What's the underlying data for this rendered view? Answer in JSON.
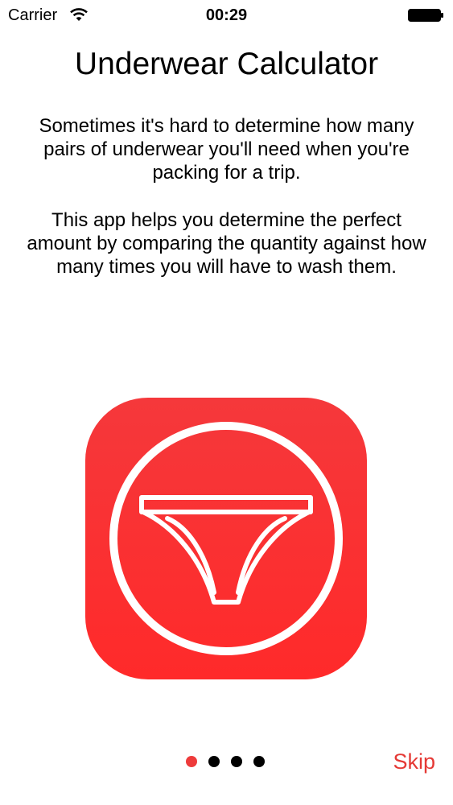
{
  "status_bar": {
    "carrier": "Carrier",
    "time": "00:29",
    "wifi_icon": "wifi-icon",
    "battery_icon": "battery-icon"
  },
  "title": "Underwear Calculator",
  "paragraphs": [
    "Sometimes it's hard to determine how many pairs of underwear you'll need when you're packing for a trip.",
    "This app helps you determine the perfect amount by comparing the quantity against how many times you will have to wash them."
  ],
  "app_icon": {
    "name": "underwear-icon",
    "color_top": "#f5383b",
    "color_bottom": "#ff2a2a"
  },
  "pager": {
    "total": 4,
    "current": 1,
    "active_color": "#ee3b3b"
  },
  "skip_label": "Skip",
  "colors": {
    "accent": "#e53935"
  }
}
